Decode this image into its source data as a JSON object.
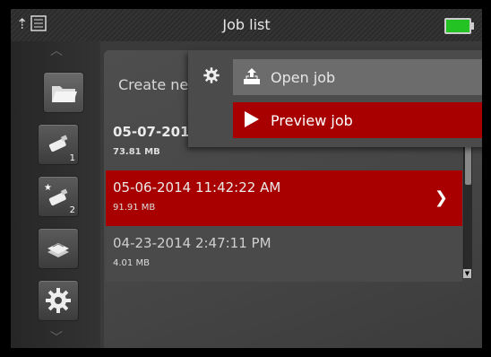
{
  "header": {
    "title": "Job list",
    "back_icon": "upload-arrow-icon",
    "list_icon": "list-icon",
    "battery_color": "#22c322"
  },
  "sidebar": {
    "items": [
      {
        "name": "folder",
        "icon": "folder-icon"
      },
      {
        "name": "usb-1",
        "icon": "usb-drive-icon",
        "badge": "1"
      },
      {
        "name": "usb-2",
        "icon": "usb-drive-star-icon",
        "badge": "2"
      },
      {
        "name": "storage",
        "icon": "disk-stack-icon"
      },
      {
        "name": "settings",
        "icon": "gear-icon"
      }
    ]
  },
  "list": {
    "create_label": "Create ne",
    "rows": [
      {
        "title": "05-07-201",
        "size": "73.81 MB",
        "selected": false
      },
      {
        "title": "05-06-2014  11:42:22 AM",
        "size": "91.91 MB",
        "selected": true
      },
      {
        "title": "04-23-2014  2:47:11 PM",
        "size": "4.01 MB",
        "selected": false
      }
    ],
    "row_arrow": "❯"
  },
  "popup": {
    "open_label": "Open job",
    "preview_label": "Preview job"
  },
  "colors": {
    "selected": "#a80000",
    "background": "#3a3a3a"
  }
}
